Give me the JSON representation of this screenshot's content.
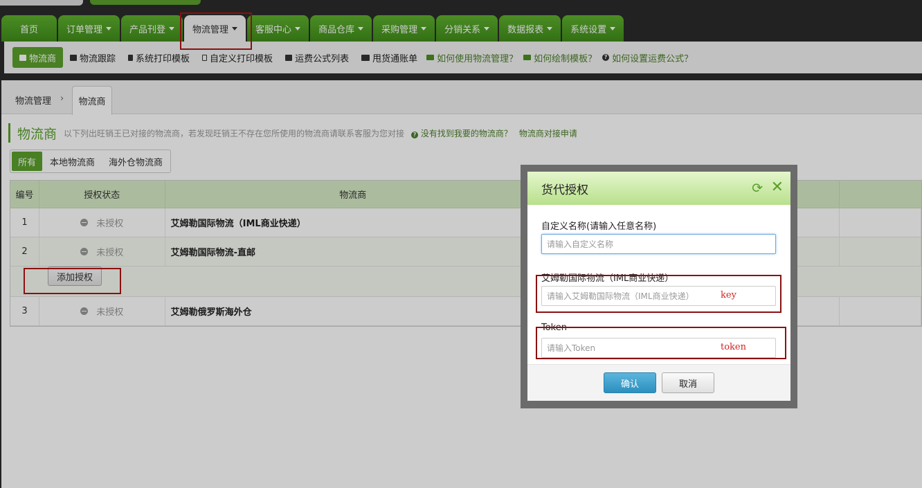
{
  "nav": {
    "tabs": [
      {
        "label": "首页"
      },
      {
        "label": "订单管理"
      },
      {
        "label": "产品刊登"
      },
      {
        "label": "物流管理"
      },
      {
        "label": "客服中心"
      },
      {
        "label": "商品仓库"
      },
      {
        "label": "采购管理"
      },
      {
        "label": "分销关系"
      },
      {
        "label": "数据报表"
      },
      {
        "label": "系统设置"
      }
    ]
  },
  "subnav": {
    "items": [
      {
        "label": "物流商"
      },
      {
        "label": "物流跟踪"
      },
      {
        "label": "系统打印模板"
      },
      {
        "label": "自定义打印模板"
      },
      {
        "label": "运费公式列表"
      },
      {
        "label": "甩货通账单"
      }
    ],
    "help": [
      {
        "label": "如何使用物流管理？"
      },
      {
        "label": "如何绘制模板？"
      },
      {
        "label": "如何设置运费公式？"
      }
    ]
  },
  "breadcrumb": {
    "root": "物流管理",
    "sep": "›",
    "current": "物流商"
  },
  "page": {
    "title": "物流商",
    "desc": "以下列出旺销王已对接的物流商，若发现旺销王不存在您所使用的物流商请联系客服为您对接",
    "link1": "没有找到我要的物流商？",
    "link2": "物流商对接申请"
  },
  "filters": [
    {
      "label": "所有"
    },
    {
      "label": "本地物流商"
    },
    {
      "label": "海外仓物流商"
    }
  ],
  "table": {
    "headers": [
      "编号",
      "授权状态",
      "物流商"
    ],
    "rows": [
      {
        "no": "1",
        "status": "未授权",
        "name": "艾姆勒国际物流（IML商业快递）"
      },
      {
        "no": "2",
        "status": "未授权",
        "name": "艾姆勒国际物流-直邮"
      },
      {
        "no": "3",
        "status": "未授权",
        "name": "艾姆勒俄罗斯海外仓"
      }
    ],
    "add_button": "添加授权"
  },
  "dialog": {
    "title": "货代授权",
    "fields": [
      {
        "label": "自定义名称(请输入任意名称)",
        "placeholder": "请输入自定义名称",
        "annotation": ""
      },
      {
        "label": "艾姆勒国际物流（IML商业快递）",
        "placeholder": "请输入艾姆勒国际物流（IML商业快递）",
        "annotation": "key"
      },
      {
        "label": "Token",
        "placeholder": "请输入Token",
        "annotation": "token"
      }
    ],
    "ok": "确认",
    "cancel": "取消"
  },
  "colors": {
    "accent": "#5aa02c",
    "annotation": "#8b1010",
    "primary_button": "#2c8fbf"
  }
}
